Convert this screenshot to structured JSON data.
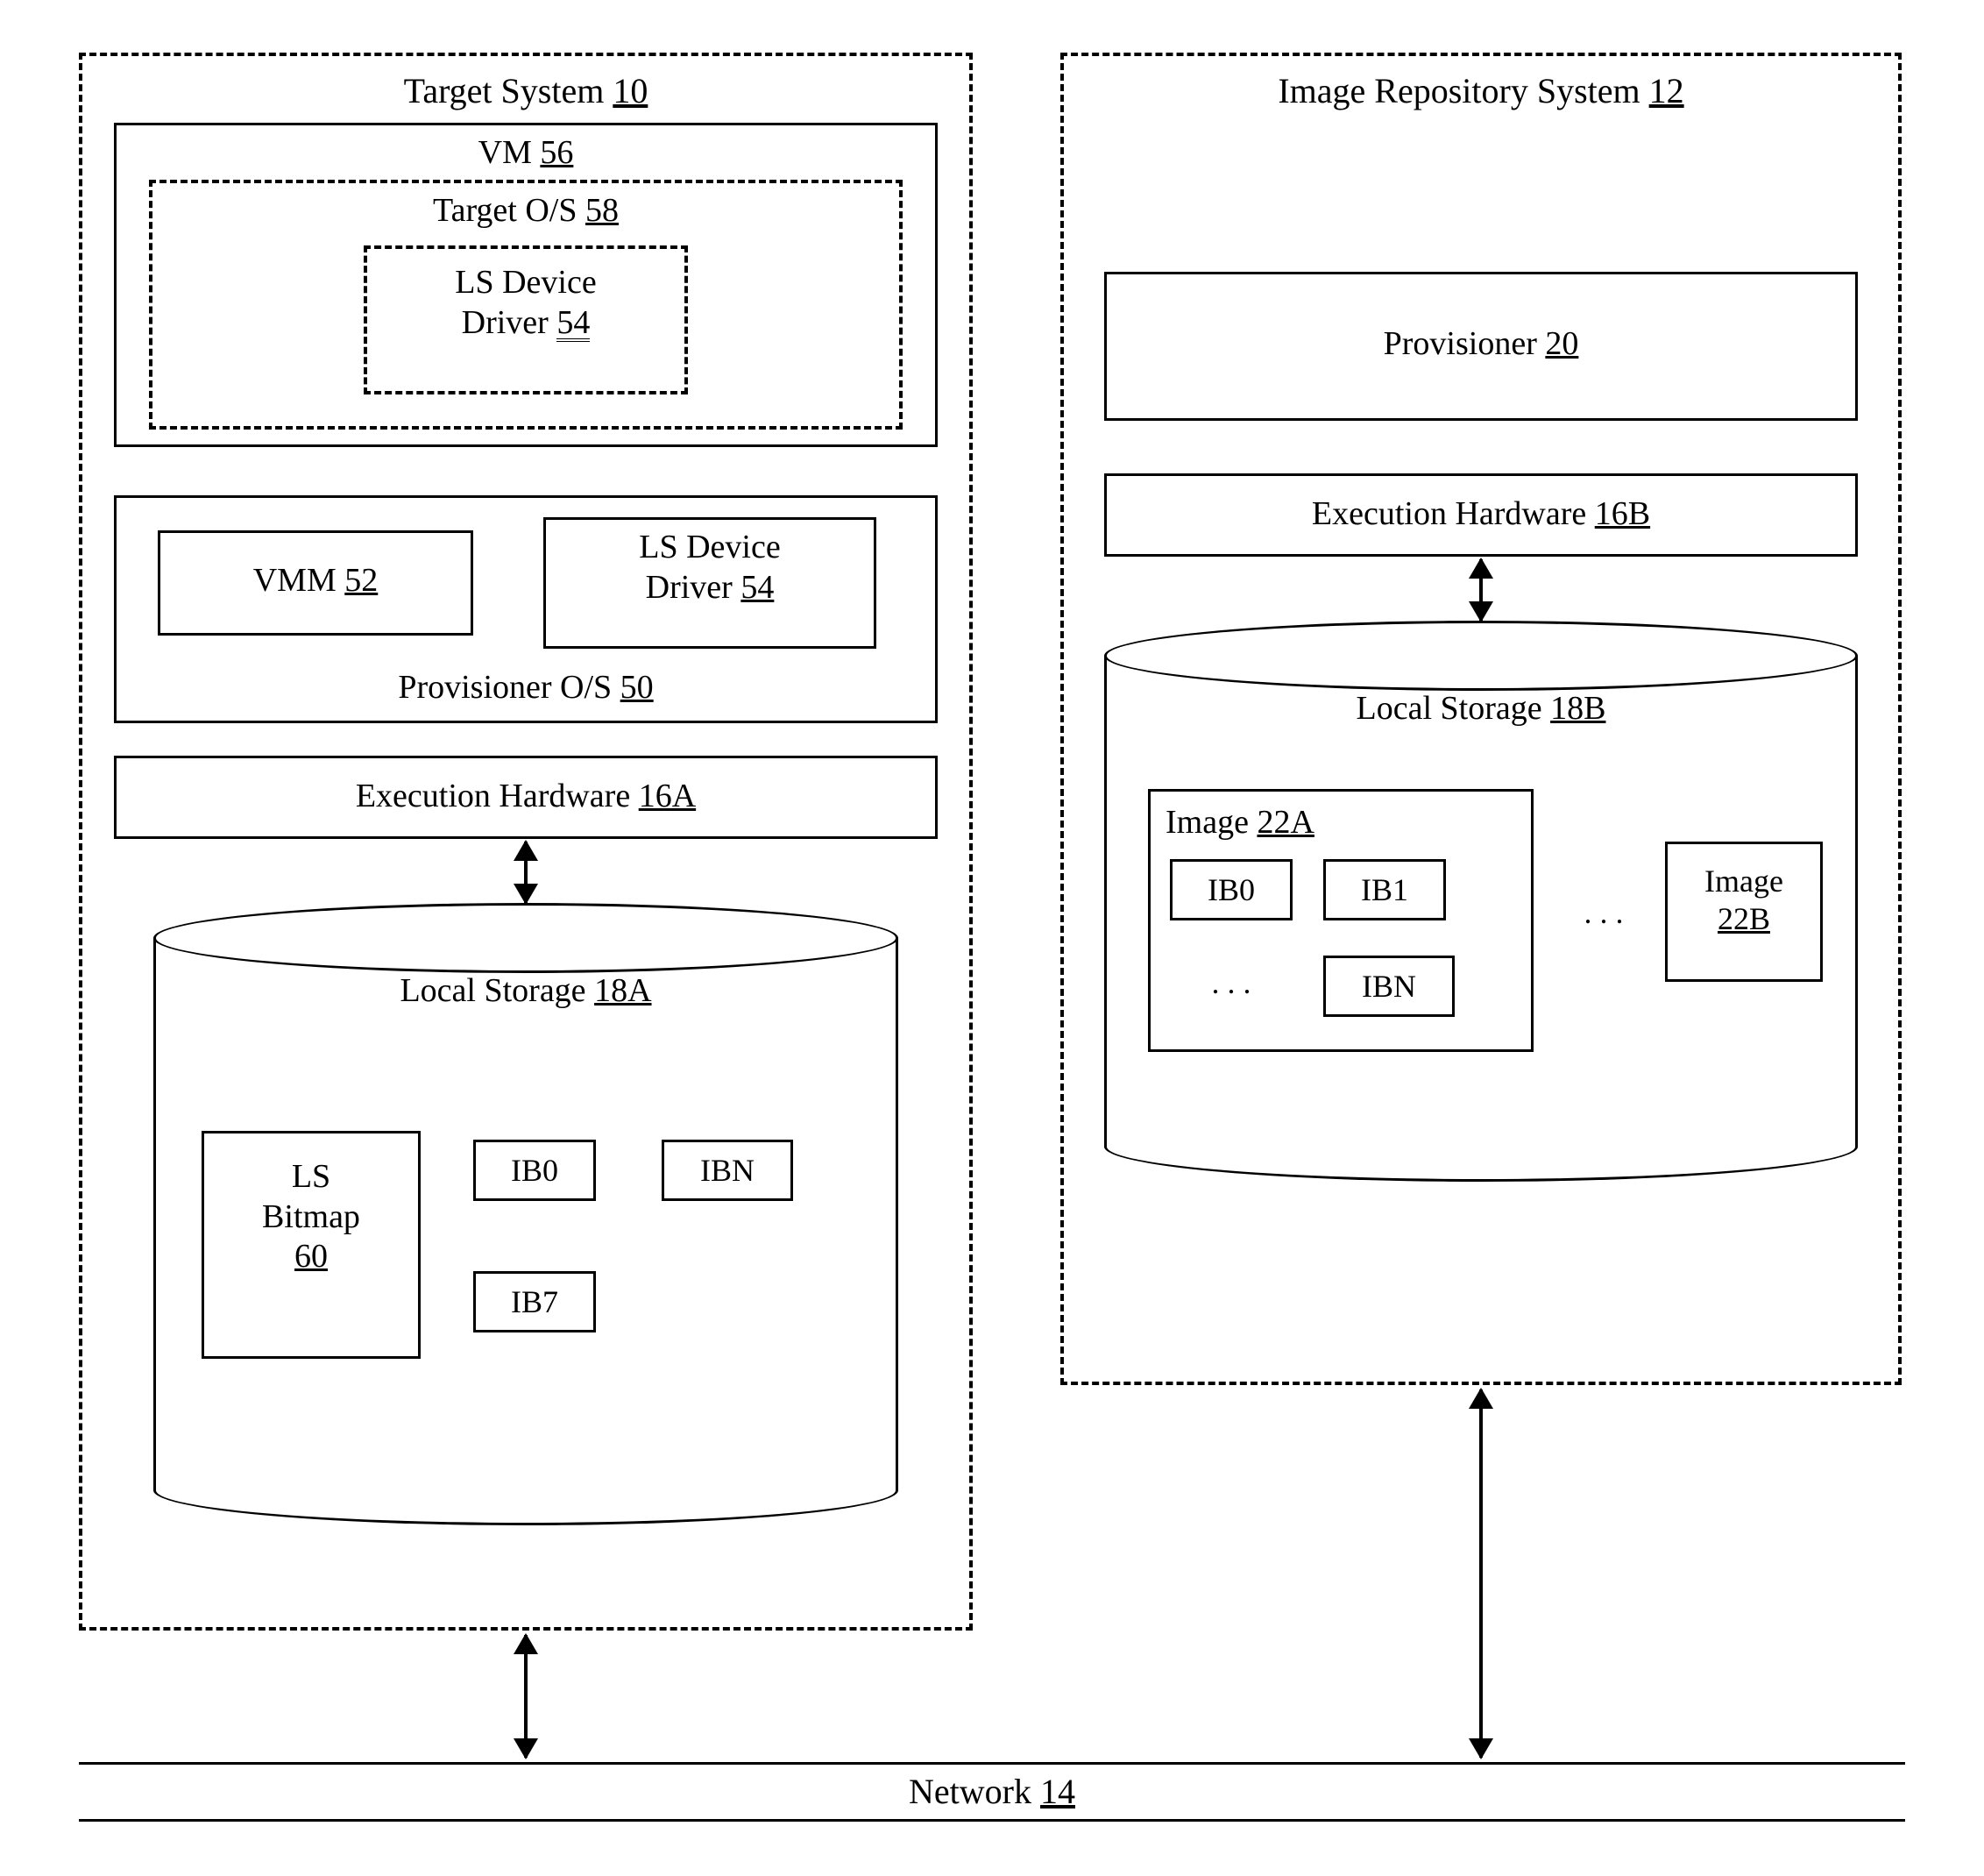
{
  "target": {
    "title": "Target System",
    "num": "10",
    "vm": {
      "label": "VM",
      "num": "56"
    },
    "targetos": {
      "label": "Target O/S",
      "num": "58"
    },
    "lsdd_in_os": {
      "label1": "LS Device",
      "label2": "Driver",
      "num": "54"
    },
    "vmm": {
      "label": "VMM",
      "num": "52"
    },
    "lsdd_low": {
      "label1": "LS Device",
      "label2": "Driver",
      "num": "54"
    },
    "provos": {
      "label": "Provisioner O/S",
      "num": "50"
    },
    "exhw": {
      "label": "Execution Hardware",
      "num": "16A"
    },
    "ls": {
      "label": "Local Storage",
      "num": "18A"
    },
    "lsbitmap": {
      "label1": "LS",
      "label2": "Bitmap",
      "num": "60"
    },
    "ib0": "IB0",
    "ibn": "IBN",
    "ib7": "IB7"
  },
  "repo": {
    "title": "Image Repository System",
    "num": "12",
    "provisioner": {
      "label": "Provisioner",
      "num": "20"
    },
    "exhw": {
      "label": "Execution Hardware",
      "num": "16B"
    },
    "ls": {
      "label": "Local Storage",
      "num": "18B"
    },
    "imageA": {
      "label": "Image",
      "num": "22A"
    },
    "ib0": "IB0",
    "ib1": "IB1",
    "ibn": "IBN",
    "dots1": ". . .",
    "dots2": ". . .",
    "imageB": {
      "label": "Image",
      "num": "22B"
    }
  },
  "network": {
    "label": "Network",
    "num": "14"
  }
}
